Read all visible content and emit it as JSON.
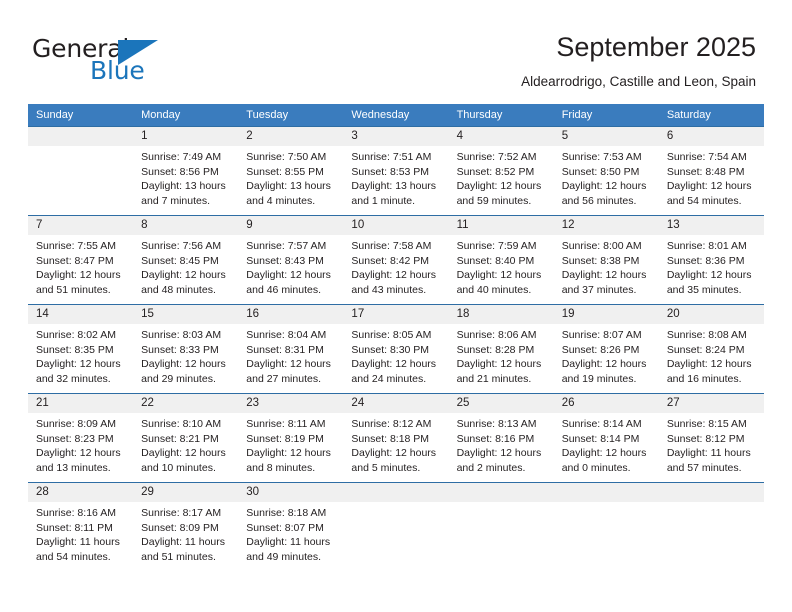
{
  "brand": {
    "name_part1": "General",
    "name_part2": "Blue"
  },
  "header": {
    "title": "September 2025",
    "location": "Aldearrodrigo, Castille and Leon, Spain"
  },
  "colors": {
    "header_blue": "#3a7cbe",
    "rule_blue": "#2e6da4",
    "numstrip_gray": "#f0f0f0",
    "brand_blue": "#1b75bb",
    "text": "#231f20"
  },
  "weekday_headers": [
    "Sunday",
    "Monday",
    "Tuesday",
    "Wednesday",
    "Thursday",
    "Friday",
    "Saturday"
  ],
  "weeks": [
    [
      {
        "day": "",
        "sunrise": "",
        "sunset": "",
        "daylight_1": "",
        "daylight_2": ""
      },
      {
        "day": "1",
        "sunrise": "Sunrise: 7:49 AM",
        "sunset": "Sunset: 8:56 PM",
        "daylight_1": "Daylight: 13 hours",
        "daylight_2": "and 7 minutes."
      },
      {
        "day": "2",
        "sunrise": "Sunrise: 7:50 AM",
        "sunset": "Sunset: 8:55 PM",
        "daylight_1": "Daylight: 13 hours",
        "daylight_2": "and 4 minutes."
      },
      {
        "day": "3",
        "sunrise": "Sunrise: 7:51 AM",
        "sunset": "Sunset: 8:53 PM",
        "daylight_1": "Daylight: 13 hours",
        "daylight_2": "and 1 minute."
      },
      {
        "day": "4",
        "sunrise": "Sunrise: 7:52 AM",
        "sunset": "Sunset: 8:52 PM",
        "daylight_1": "Daylight: 12 hours",
        "daylight_2": "and 59 minutes."
      },
      {
        "day": "5",
        "sunrise": "Sunrise: 7:53 AM",
        "sunset": "Sunset: 8:50 PM",
        "daylight_1": "Daylight: 12 hours",
        "daylight_2": "and 56 minutes."
      },
      {
        "day": "6",
        "sunrise": "Sunrise: 7:54 AM",
        "sunset": "Sunset: 8:48 PM",
        "daylight_1": "Daylight: 12 hours",
        "daylight_2": "and 54 minutes."
      }
    ],
    [
      {
        "day": "7",
        "sunrise": "Sunrise: 7:55 AM",
        "sunset": "Sunset: 8:47 PM",
        "daylight_1": "Daylight: 12 hours",
        "daylight_2": "and 51 minutes."
      },
      {
        "day": "8",
        "sunrise": "Sunrise: 7:56 AM",
        "sunset": "Sunset: 8:45 PM",
        "daylight_1": "Daylight: 12 hours",
        "daylight_2": "and 48 minutes."
      },
      {
        "day": "9",
        "sunrise": "Sunrise: 7:57 AM",
        "sunset": "Sunset: 8:43 PM",
        "daylight_1": "Daylight: 12 hours",
        "daylight_2": "and 46 minutes."
      },
      {
        "day": "10",
        "sunrise": "Sunrise: 7:58 AM",
        "sunset": "Sunset: 8:42 PM",
        "daylight_1": "Daylight: 12 hours",
        "daylight_2": "and 43 minutes."
      },
      {
        "day": "11",
        "sunrise": "Sunrise: 7:59 AM",
        "sunset": "Sunset: 8:40 PM",
        "daylight_1": "Daylight: 12 hours",
        "daylight_2": "and 40 minutes."
      },
      {
        "day": "12",
        "sunrise": "Sunrise: 8:00 AM",
        "sunset": "Sunset: 8:38 PM",
        "daylight_1": "Daylight: 12 hours",
        "daylight_2": "and 37 minutes."
      },
      {
        "day": "13",
        "sunrise": "Sunrise: 8:01 AM",
        "sunset": "Sunset: 8:36 PM",
        "daylight_1": "Daylight: 12 hours",
        "daylight_2": "and 35 minutes."
      }
    ],
    [
      {
        "day": "14",
        "sunrise": "Sunrise: 8:02 AM",
        "sunset": "Sunset: 8:35 PM",
        "daylight_1": "Daylight: 12 hours",
        "daylight_2": "and 32 minutes."
      },
      {
        "day": "15",
        "sunrise": "Sunrise: 8:03 AM",
        "sunset": "Sunset: 8:33 PM",
        "daylight_1": "Daylight: 12 hours",
        "daylight_2": "and 29 minutes."
      },
      {
        "day": "16",
        "sunrise": "Sunrise: 8:04 AM",
        "sunset": "Sunset: 8:31 PM",
        "daylight_1": "Daylight: 12 hours",
        "daylight_2": "and 27 minutes."
      },
      {
        "day": "17",
        "sunrise": "Sunrise: 8:05 AM",
        "sunset": "Sunset: 8:30 PM",
        "daylight_1": "Daylight: 12 hours",
        "daylight_2": "and 24 minutes."
      },
      {
        "day": "18",
        "sunrise": "Sunrise: 8:06 AM",
        "sunset": "Sunset: 8:28 PM",
        "daylight_1": "Daylight: 12 hours",
        "daylight_2": "and 21 minutes."
      },
      {
        "day": "19",
        "sunrise": "Sunrise: 8:07 AM",
        "sunset": "Sunset: 8:26 PM",
        "daylight_1": "Daylight: 12 hours",
        "daylight_2": "and 19 minutes."
      },
      {
        "day": "20",
        "sunrise": "Sunrise: 8:08 AM",
        "sunset": "Sunset: 8:24 PM",
        "daylight_1": "Daylight: 12 hours",
        "daylight_2": "and 16 minutes."
      }
    ],
    [
      {
        "day": "21",
        "sunrise": "Sunrise: 8:09 AM",
        "sunset": "Sunset: 8:23 PM",
        "daylight_1": "Daylight: 12 hours",
        "daylight_2": "and 13 minutes."
      },
      {
        "day": "22",
        "sunrise": "Sunrise: 8:10 AM",
        "sunset": "Sunset: 8:21 PM",
        "daylight_1": "Daylight: 12 hours",
        "daylight_2": "and 10 minutes."
      },
      {
        "day": "23",
        "sunrise": "Sunrise: 8:11 AM",
        "sunset": "Sunset: 8:19 PM",
        "daylight_1": "Daylight: 12 hours",
        "daylight_2": "and 8 minutes."
      },
      {
        "day": "24",
        "sunrise": "Sunrise: 8:12 AM",
        "sunset": "Sunset: 8:18 PM",
        "daylight_1": "Daylight: 12 hours",
        "daylight_2": "and 5 minutes."
      },
      {
        "day": "25",
        "sunrise": "Sunrise: 8:13 AM",
        "sunset": "Sunset: 8:16 PM",
        "daylight_1": "Daylight: 12 hours",
        "daylight_2": "and 2 minutes."
      },
      {
        "day": "26",
        "sunrise": "Sunrise: 8:14 AM",
        "sunset": "Sunset: 8:14 PM",
        "daylight_1": "Daylight: 12 hours",
        "daylight_2": "and 0 minutes."
      },
      {
        "day": "27",
        "sunrise": "Sunrise: 8:15 AM",
        "sunset": "Sunset: 8:12 PM",
        "daylight_1": "Daylight: 11 hours",
        "daylight_2": "and 57 minutes."
      }
    ],
    [
      {
        "day": "28",
        "sunrise": "Sunrise: 8:16 AM",
        "sunset": "Sunset: 8:11 PM",
        "daylight_1": "Daylight: 11 hours",
        "daylight_2": "and 54 minutes."
      },
      {
        "day": "29",
        "sunrise": "Sunrise: 8:17 AM",
        "sunset": "Sunset: 8:09 PM",
        "daylight_1": "Daylight: 11 hours",
        "daylight_2": "and 51 minutes."
      },
      {
        "day": "30",
        "sunrise": "Sunrise: 8:18 AM",
        "sunset": "Sunset: 8:07 PM",
        "daylight_1": "Daylight: 11 hours",
        "daylight_2": "and 49 minutes."
      },
      {
        "day": "",
        "sunrise": "",
        "sunset": "",
        "daylight_1": "",
        "daylight_2": ""
      },
      {
        "day": "",
        "sunrise": "",
        "sunset": "",
        "daylight_1": "",
        "daylight_2": ""
      },
      {
        "day": "",
        "sunrise": "",
        "sunset": "",
        "daylight_1": "",
        "daylight_2": ""
      },
      {
        "day": "",
        "sunrise": "",
        "sunset": "",
        "daylight_1": "",
        "daylight_2": ""
      }
    ]
  ]
}
